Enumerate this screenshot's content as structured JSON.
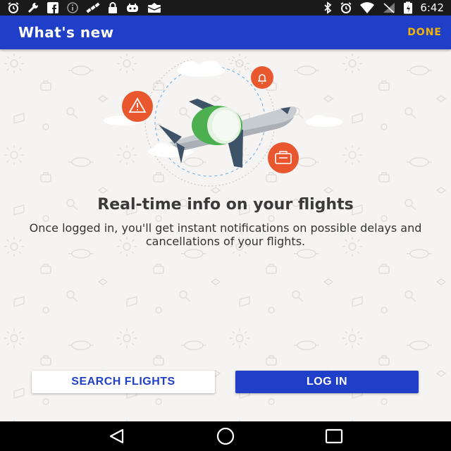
{
  "status_bar": {
    "time": "6:42",
    "icons_left": [
      "alarm-icon",
      "wrench-icon",
      "facebook-icon",
      "info-icon",
      "satellite-icon",
      "lock-icon",
      "gamepad-icon",
      "mail-icon"
    ],
    "icons_right": [
      "bluetooth-icon",
      "alarm-icon",
      "wifi-icon",
      "signal-icon",
      "battery-icon"
    ]
  },
  "app_bar": {
    "title": "What's new",
    "done_label": "DONE",
    "background_color": "#1f3fc9",
    "done_color": "#f4b400"
  },
  "onboarding": {
    "headline": "Real-time info on your flights",
    "description": "Once logged in, you'll get instant notifications on possible delays and cancellations of your flights.",
    "illustration": {
      "subject": "airplane",
      "badges": [
        "bell-icon",
        "warning-icon",
        "suitcase-icon"
      ],
      "accent_color": "#e8572e",
      "engine_color": "#4cb050"
    }
  },
  "actions": {
    "search_flights_label": "SEARCH FLIGHTS",
    "log_in_label": "LOG IN"
  },
  "nav_bar": {
    "buttons": [
      "back-icon",
      "home-icon",
      "recents-icon"
    ]
  }
}
